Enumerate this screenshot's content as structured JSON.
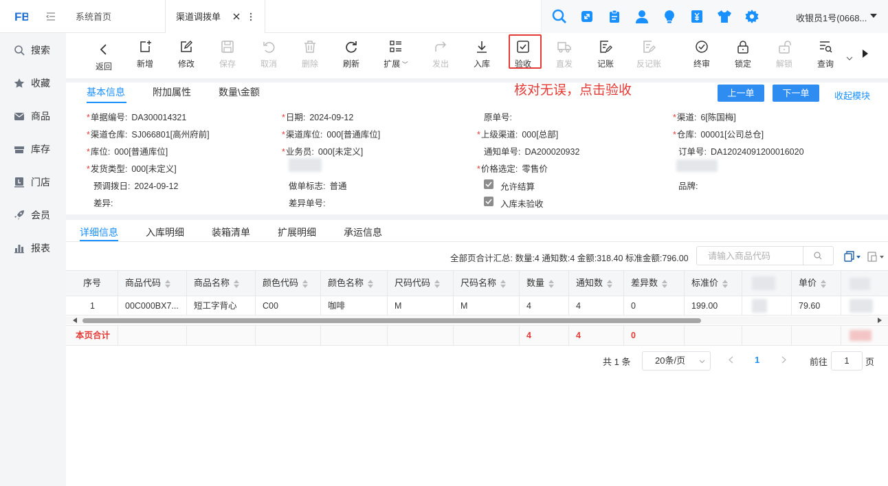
{
  "header": {
    "tabs": [
      {
        "label": "系统首页"
      },
      {
        "label": "渠道调拨单"
      }
    ],
    "user": "收银员1号(0668..."
  },
  "sidebar": {
    "items": [
      {
        "label": "搜索",
        "icon": "search-icon"
      },
      {
        "label": "收藏",
        "icon": "star-icon"
      },
      {
        "label": "商品",
        "icon": "mail-icon"
      },
      {
        "label": "库存",
        "icon": "inventory-icon"
      },
      {
        "label": "门店",
        "icon": "store-icon"
      },
      {
        "label": "会员",
        "icon": "rocket-icon"
      },
      {
        "label": "报表",
        "icon": "chart-icon"
      }
    ]
  },
  "toolbar": {
    "buttons": [
      {
        "label": "返回",
        "enabled": true
      },
      {
        "label": "新增",
        "enabled": true
      },
      {
        "label": "修改",
        "enabled": true
      },
      {
        "label": "保存",
        "enabled": false
      },
      {
        "label": "取消",
        "enabled": false
      },
      {
        "label": "删除",
        "enabled": false
      },
      {
        "label": "刷新",
        "enabled": true
      },
      {
        "label": "扩展",
        "enabled": true
      },
      {
        "label": "发出",
        "enabled": false
      },
      {
        "label": "入库",
        "enabled": true
      },
      {
        "label": "验收",
        "enabled": true
      },
      {
        "label": "直发",
        "enabled": false
      },
      {
        "label": "记账",
        "enabled": true
      },
      {
        "label": "反记账",
        "enabled": false
      },
      {
        "label": "终审",
        "enabled": true
      },
      {
        "label": "锁定",
        "enabled": true
      },
      {
        "label": "解锁",
        "enabled": false
      },
      {
        "label": "查询",
        "enabled": true
      }
    ]
  },
  "annotation": "核对无误，点击验收",
  "form": {
    "tabs": [
      "基本信息",
      "附加属性",
      "数量\\金额"
    ],
    "prev_button": "上一单",
    "next_button": "下一单",
    "collapse_link": "收起模块",
    "fields": {
      "doc_no": {
        "label": "单据编号:",
        "value": "DA300014321"
      },
      "date": {
        "label": "日期:",
        "value": "2024-09-12"
      },
      "orig_no": {
        "label": "原单号:",
        "value": ""
      },
      "channel": {
        "label": "渠道:",
        "value": "6[陈国梅]"
      },
      "channel_wh": {
        "label": "渠道仓库:",
        "value": "SJ066801[高州府前]"
      },
      "channel_loc": {
        "label": "渠道库位:",
        "value": "000[普通库位]"
      },
      "parent_channel": {
        "label": "上级渠道:",
        "value": "000[总部]"
      },
      "warehouse": {
        "label": "仓库:",
        "value": "00001[公司总仓]"
      },
      "location": {
        "label": "库位:",
        "value": "000[普通库位]"
      },
      "salesman": {
        "label": "业务员:",
        "value": "000[未定义]"
      },
      "notice_no": {
        "label": "通知单号:",
        "value": "DA200020932"
      },
      "order_no": {
        "label": "订单号:",
        "value": "DA12024091200016020"
      },
      "ship_type": {
        "label": "发货类型:",
        "value": "000[未定义]"
      },
      "price_sel": {
        "label": "价格选定:",
        "value": "零售价"
      },
      "pre_date": {
        "label": "预调拨日:",
        "value": "2024-09-12"
      },
      "maker_flag": {
        "label": "做单标志:",
        "value": "普通"
      },
      "allow_settle": {
        "label": "允许结算",
        "checked": true
      },
      "brand": {
        "label": "品牌:",
        "value": ""
      },
      "diff": {
        "label": "差异:",
        "value": ""
      },
      "diff_no": {
        "label": "差异单号:",
        "value": ""
      },
      "in_unchecked": {
        "label": "入库未验收",
        "checked": true
      }
    }
  },
  "detail": {
    "tabs": [
      "详细信息",
      "入库明细",
      "装箱清单",
      "扩展明细",
      "承运信息"
    ],
    "summary": "全部页合计汇总:  数量:4 通知数:4 金额:318.40 标准金额:796.00",
    "search_placeholder": "请输入商品代码",
    "columns": [
      "序号",
      "商品代码",
      "商品名称",
      "颜色代码",
      "颜色名称",
      "尺码代码",
      "尺码名称",
      "数量",
      "通知数",
      "差异数",
      "标准价",
      "",
      "单价",
      ""
    ],
    "rows": [
      [
        "1",
        "00C000BX7...",
        "短工字背心",
        "C00",
        "咖啡",
        "M",
        "M",
        "4",
        "4",
        "0",
        "199.00",
        "",
        "79.60",
        ""
      ]
    ],
    "footer": {
      "label": "本页合计",
      "qty": "4",
      "notice": "4",
      "diff": "0"
    }
  },
  "pagination": {
    "total": "共 1 条",
    "page_size": "20条/页",
    "current": "1",
    "goto_label": "前往",
    "goto_value": "1",
    "page_suffix": "页"
  },
  "colors": {
    "accent": "#1890ff",
    "danger": "#e53935",
    "button": "#2f8cf0"
  }
}
